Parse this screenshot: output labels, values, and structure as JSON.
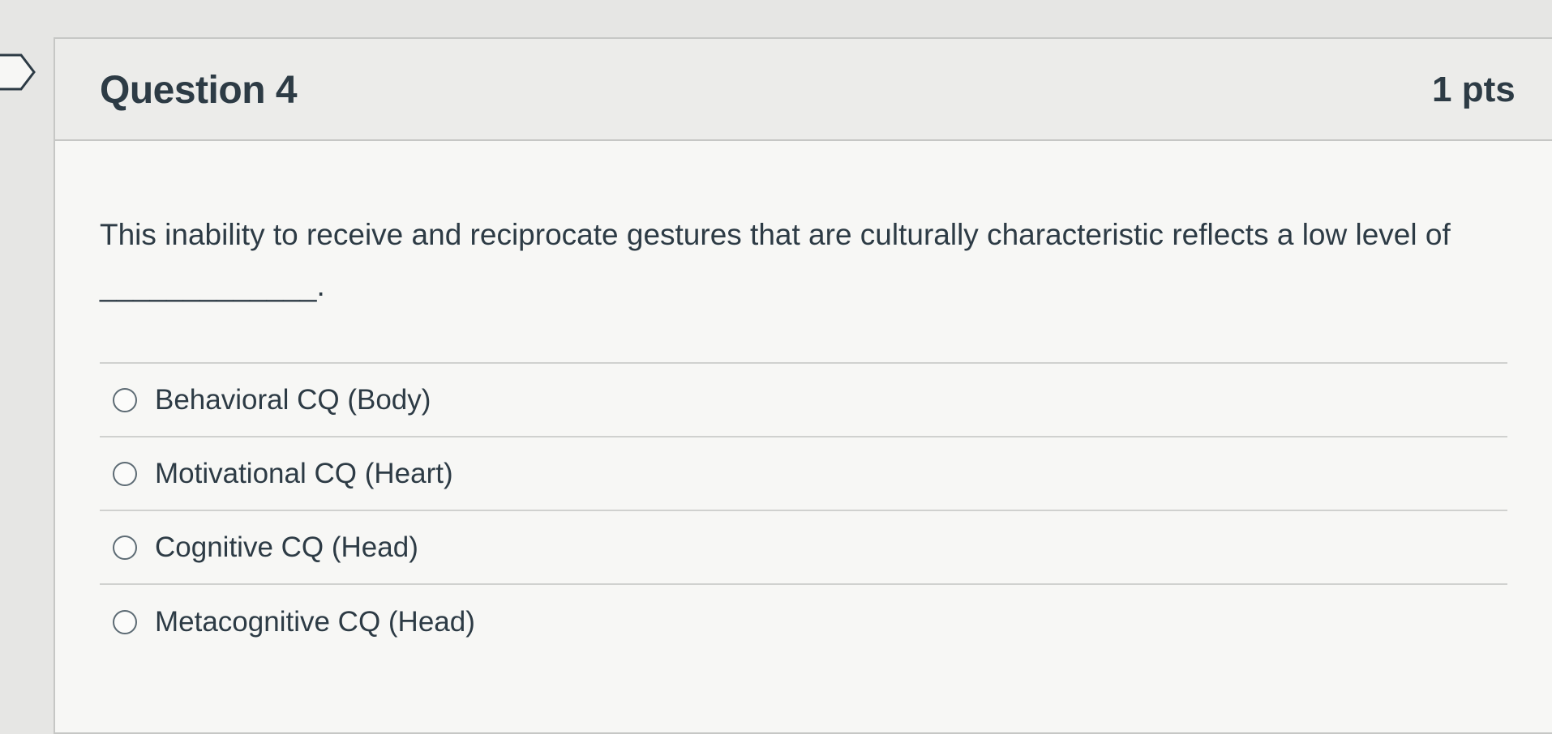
{
  "question": {
    "title": "Question 4",
    "points": "1 pts",
    "text": "This inability to receive and reciprocate gestures that are culturally characteristic reflects a low level of _____________."
  },
  "answers": [
    {
      "label": "Behavioral CQ (Body)",
      "selected": false
    },
    {
      "label": "Motivational CQ (Heart)",
      "selected": false
    },
    {
      "label": "Cognitive CQ (Head)",
      "selected": false
    },
    {
      "label": "Metacognitive CQ (Head)",
      "selected": false
    }
  ],
  "icons": {
    "flag": "flag-question-icon",
    "radio": "radio-button-icon"
  }
}
